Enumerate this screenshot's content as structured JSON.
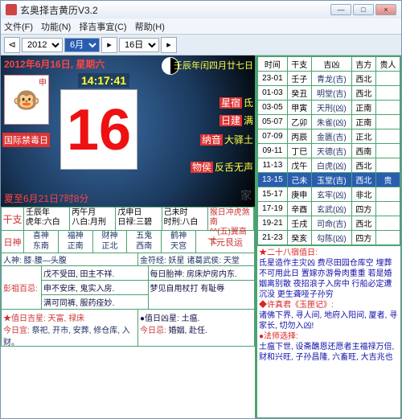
{
  "window": {
    "title": "玄奥择吉黄历V3.2"
  },
  "menu": {
    "file": "文件(F)",
    "func": "功能(N)",
    "zj": "择吉事宜(C)",
    "help": "帮助(H)"
  },
  "toolbar": {
    "year": "2012",
    "month": "6月",
    "day": "16日"
  },
  "earth": {
    "dateline": "2012年6月16日, 星期六",
    "ganzhi_right": "壬辰年闰四月廿七日",
    "monkey_label": "申",
    "red_label": "国际禁毒日",
    "clock": "14:17:41",
    "bigday": "16",
    "rows": [
      {
        "k": "星宿",
        "v": "氐"
      },
      {
        "k": "日建",
        "v": "满"
      },
      {
        "k": "纳音",
        "v": "大驿土"
      },
      {
        "k": "物侯",
        "v": "反舌无声"
      }
    ],
    "bottom": "夏至6月21日7时8分",
    "watermark": "家"
  },
  "ganzhi": {
    "label": "干支",
    "cells": [
      "壬辰年\n虎年:六白",
      "丙午月\n八白:月刑",
      "戊申日\n日禄:三碧",
      "己未时\n时刑:八白"
    ],
    "extra": "猴日冲虎煞南\n^^(五)翼高士"
  },
  "rishen": {
    "label": "日神",
    "items": [
      "喜神\n东南",
      "福神\n正南",
      "财神\n正北",
      "五鬼\n西南",
      "鹤神\n天宫",
      "—"
    ],
    "yun": "下元艮运"
  },
  "row_a": {
    "l": "人神: 膝·腰—头腹",
    "r": "金符经: 妖星   诸葛武侯: 天堂"
  },
  "pengzu": {
    "label": "彭祖百忌:",
    "lines": [
      "戊不受田, 田主不祥.",
      "申不安床, 鬼实入房.",
      "满可同裤, 服药痊妙."
    ],
    "rlines": [
      "每日胎神: 房床炉房内东.",
      "梦见自用杖打  有耻辱"
    ]
  },
  "jixing": {
    "star_title": "★值日吉星: 天富, 禄床",
    "today_label": "今日宜:",
    "today_text": "祭祀, 开市, 安葬, 修仓库, 入财。",
    "r_title": "●值日凶星:  土瘟.",
    "r_label": "今日忌:",
    "r_text": "婚姻, 赴任."
  },
  "hourtable": {
    "headers": [
      "时间",
      "干支",
      "吉凶",
      "吉方",
      "贵人"
    ],
    "rows": [
      {
        "t": "23-01",
        "gz": "壬子",
        "jx": "青龙(吉)",
        "jf": "西北",
        "gr": ""
      },
      {
        "t": "01-03",
        "gz": "癸丑",
        "jx": "明堂(吉)",
        "jf": "西北",
        "gr": ""
      },
      {
        "t": "03-05",
        "gz": "甲寅",
        "jx": "天刑(凶)",
        "jf": "正南",
        "gr": ""
      },
      {
        "t": "05-07",
        "gz": "乙卯",
        "jx": "朱雀(凶)",
        "jf": "正南",
        "gr": ""
      },
      {
        "t": "07-09",
        "gz": "丙辰",
        "jx": "金匮(吉)",
        "jf": "正北",
        "gr": ""
      },
      {
        "t": "09-11",
        "gz": "丁巳",
        "jx": "天德(吉)",
        "jf": "西南",
        "gr": ""
      },
      {
        "t": "11-13",
        "gz": "戊午",
        "jx": "白虎(凶)",
        "jf": "西北",
        "gr": ""
      },
      {
        "t": "13-15",
        "gz": "己未",
        "jx": "玉堂(吉)",
        "jf": "西北",
        "gr": "贵",
        "sel": true
      },
      {
        "t": "15-17",
        "gz": "庚申",
        "jx": "玄牢(凶)",
        "jf": "非北",
        "gr": ""
      },
      {
        "t": "17-19",
        "gz": "辛酉",
        "jx": "玄武(凶)",
        "jf": "四方",
        "gr": ""
      },
      {
        "t": "19-21",
        "gz": "壬戌",
        "jx": "司命(吉)",
        "jf": "西北",
        "gr": ""
      },
      {
        "t": "21-23",
        "gz": "癸亥",
        "jx": "勾陈(凶)",
        "jf": "四方",
        "gr": ""
      }
    ]
  },
  "notes": {
    "lines": [
      "★二十八宿值日:",
      "氐星造作主灾凶 费尽田园仓库空 埋葬不可用此日 置嫁亦游骨肉重重 若是婚姻离别散 夜招浪子入房中 行船必定遭沉没 更生聋哑子孙穷",
      "",
      "◆许真君《玉匣记》:",
      "诸佛下界, 寻人间, 地府入阳间, 厦者, 寻家长, 切勿入凶!",
      "",
      "●法师选择:",
      "土瘟下世, 设斋醮恩还愿者主福禄万倍, 财和兴旺, 子孙昌隆, 六畜旺, 大吉兆也"
    ]
  }
}
